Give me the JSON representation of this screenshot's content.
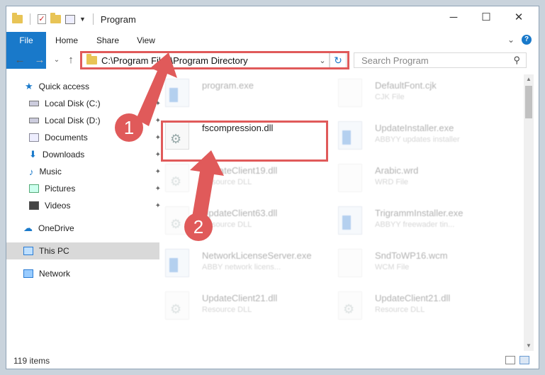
{
  "window": {
    "title": "Program",
    "controls": {
      "minimize": "─",
      "maximize": "☐",
      "close": "✕"
    }
  },
  "ribbon": {
    "tabs": [
      "File",
      "Home",
      "Share",
      "View"
    ],
    "expand": "⌄",
    "help": "?"
  },
  "nav": {
    "back": "←",
    "forward": "→",
    "recent": "⌄",
    "up": "↑",
    "address": "C:\\Program Files\\Program Directory",
    "address_dropdown": "⌄",
    "refresh": "↻",
    "search_placeholder": "Search Program",
    "search_icon": "⚲"
  },
  "sidebar": {
    "items": [
      {
        "label": "Quick access",
        "icon": "star-icon",
        "pinned": false
      },
      {
        "label": "Local Disk (C:)",
        "icon": "drive-icon",
        "pinned": true
      },
      {
        "label": "Local Disk (D:)",
        "icon": "drive-icon",
        "pinned": true
      },
      {
        "label": "Documents",
        "icon": "documents-icon",
        "pinned": true
      },
      {
        "label": "Downloads",
        "icon": "download-icon",
        "pinned": true
      },
      {
        "label": "Music",
        "icon": "music-icon",
        "pinned": true
      },
      {
        "label": "Pictures",
        "icon": "pictures-icon",
        "pinned": true
      },
      {
        "label": "Videos",
        "icon": "videos-icon",
        "pinned": true
      },
      {
        "label": "OneDrive",
        "icon": "cloud-icon",
        "pinned": false
      },
      {
        "label": "This PC",
        "icon": "pc-icon",
        "pinned": false,
        "selected": true
      },
      {
        "label": "Network",
        "icon": "network-icon",
        "pinned": false
      }
    ],
    "pin_glyph": "📌"
  },
  "files": [
    {
      "name": "program.exe",
      "type": "",
      "kind": "exe"
    },
    {
      "name": "DefaultFont.cjk",
      "type": "CJK File",
      "kind": "doc"
    },
    {
      "name": "fscompression.dll",
      "type": "",
      "kind": "dll"
    },
    {
      "name": "UpdateInstaller.exe",
      "type": "ABBYY updates installer",
      "kind": "exe"
    },
    {
      "name": "UpdateClient19.dll",
      "type": "Resource DLL",
      "kind": "dll"
    },
    {
      "name": "Arabic.wrd",
      "type": "WRD File",
      "kind": "doc"
    },
    {
      "name": "UpdateClient63.dll",
      "type": "Resource DLL",
      "kind": "dll"
    },
    {
      "name": "TrigrammInstaller.exe",
      "type": "ABBYY freewader tin...",
      "kind": "exe"
    },
    {
      "name": "NetworkLicenseServer.exe",
      "type": "ABBY network licens...",
      "kind": "exe"
    },
    {
      "name": "SndToWP16.wcm",
      "type": "WCM File",
      "kind": "doc"
    },
    {
      "name": "UpdateClient21.dll",
      "type": "Resource DLL",
      "kind": "dll"
    },
    {
      "name": "UpdateClient21.dll",
      "type": "Resource DLL",
      "kind": "dll"
    }
  ],
  "status": {
    "items": "119 items"
  },
  "annotations": {
    "step1": "1",
    "step2": "2"
  },
  "colors": {
    "accent": "#1979ca",
    "highlight": "#e05a5a"
  }
}
